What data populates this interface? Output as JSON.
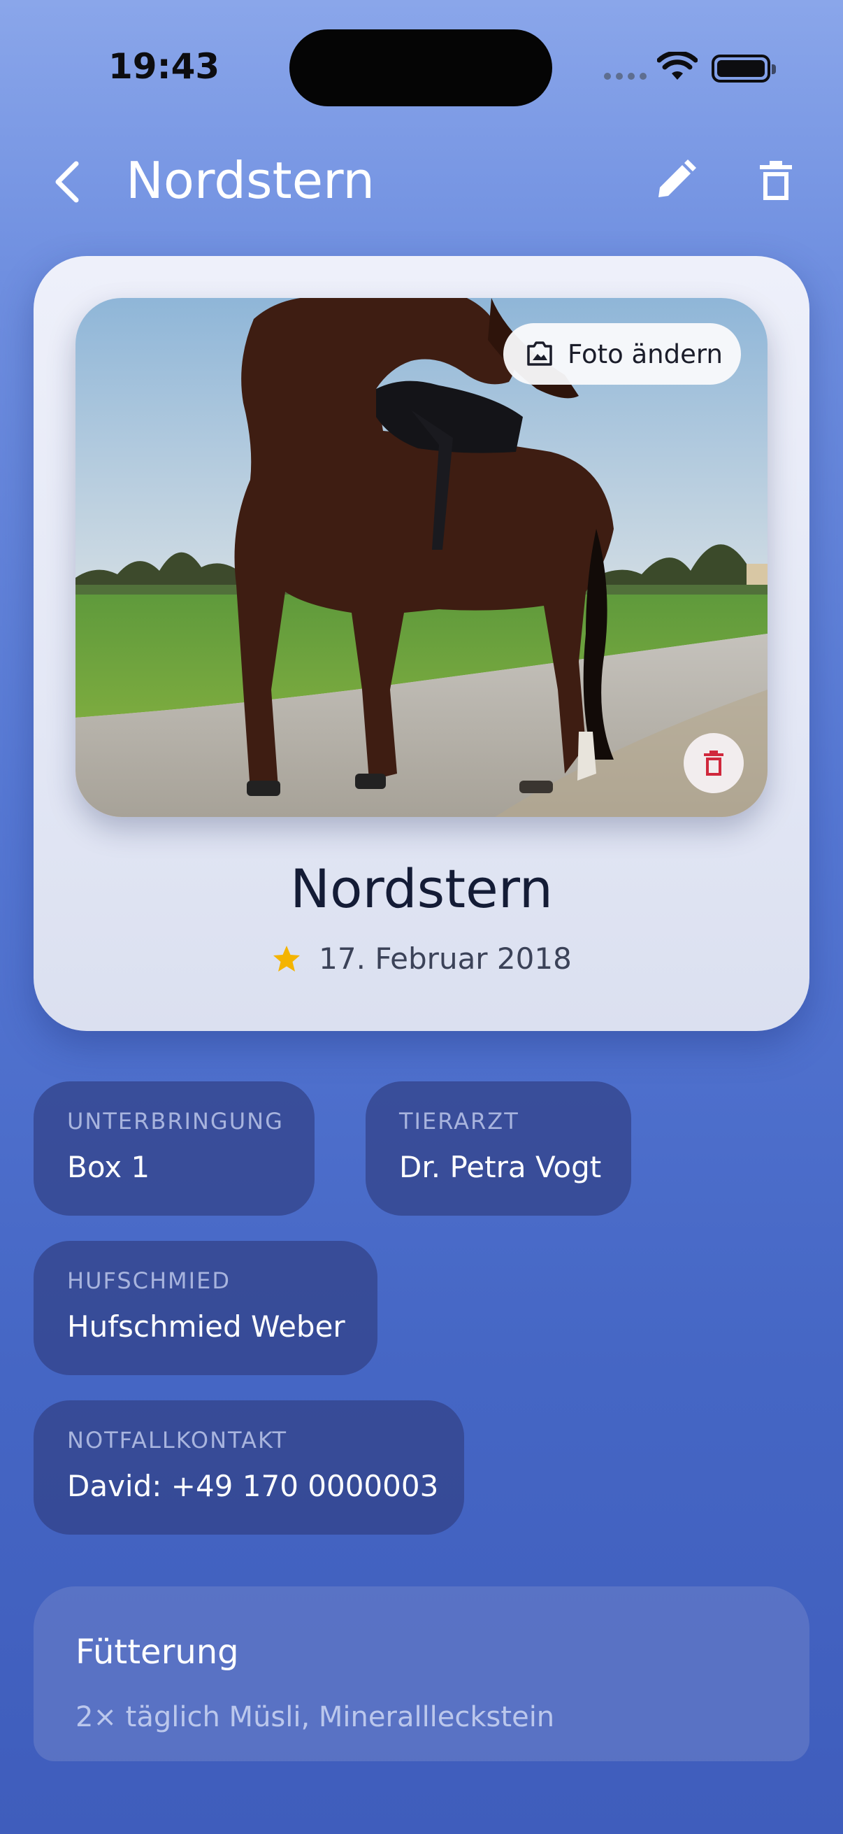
{
  "status_bar": {
    "time": "19:43"
  },
  "nav": {
    "title": "Nordstern"
  },
  "card": {
    "change_photo_label": "Foto ändern",
    "name": "Nordstern",
    "date": "17. Februar 2018"
  },
  "info": [
    {
      "label": "UNTERBRINGUNG",
      "value": "Box 1"
    },
    {
      "label": "TIERARZT",
      "value": "Dr. Petra Vogt"
    },
    {
      "label": "HUFSCHMIED",
      "value": "Hufschmied Weber"
    },
    {
      "label": "NOTFALLKONTAKT",
      "value": "David: +49 170 0000003"
    }
  ],
  "feeding": {
    "title": "Fütterung",
    "text": "2× täglich Müsli, Minerallleckstein"
  },
  "colors": {
    "accent_star": "#f4b400",
    "delete_red": "#d0283c"
  },
  "icons": [
    "back-chevron-icon",
    "pencil-icon",
    "trash-icon",
    "photo-icon",
    "star-icon",
    "wifi-icon",
    "battery-icon"
  ]
}
